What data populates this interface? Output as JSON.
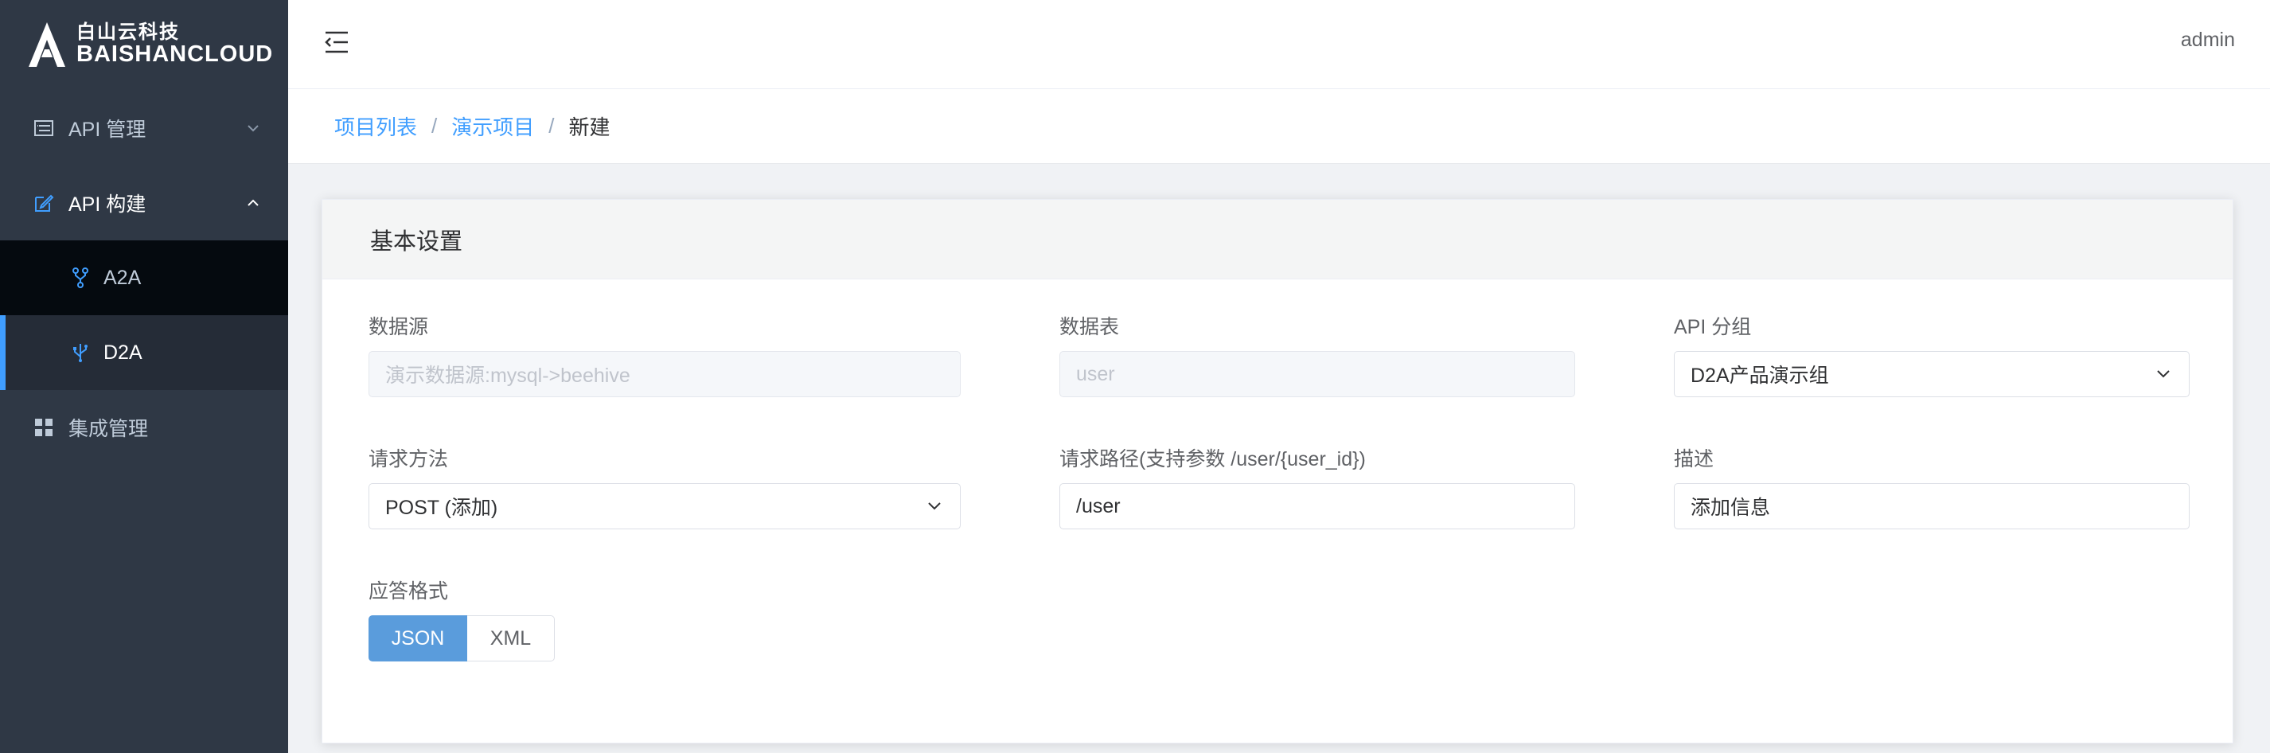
{
  "logo": {
    "cn": "白山云科技",
    "en": "BAISHANCLOUD"
  },
  "sidebar": {
    "items": [
      {
        "label": "API 管理",
        "icon": "list-icon"
      },
      {
        "label": "API 构建",
        "icon": "edit-icon"
      },
      {
        "label": "集成管理",
        "icon": "grid-icon"
      }
    ],
    "submenu": [
      {
        "label": "A2A",
        "icon": "fork-icon"
      },
      {
        "label": "D2A",
        "icon": "usb-icon"
      }
    ]
  },
  "header": {
    "user": "admin"
  },
  "breadcrumb": {
    "item1": "项目列表",
    "item2": "演示项目",
    "current": "新建",
    "sep": "/"
  },
  "card": {
    "title": "基本设置",
    "datasource": {
      "label": "数据源",
      "placeholder": "演示数据源:mysql->beehive"
    },
    "datatable": {
      "label": "数据表",
      "placeholder": "user"
    },
    "api_group": {
      "label": "API 分组",
      "value": "D2A产品演示组"
    },
    "method": {
      "label": "请求方法",
      "value": "POST (添加)"
    },
    "path": {
      "label": "请求路径(支持参数 /user/{user_id})",
      "value": "/user"
    },
    "desc": {
      "label": "描述",
      "value": "添加信息"
    },
    "format": {
      "label": "应答格式",
      "options": [
        "JSON",
        "XML"
      ],
      "selected": "JSON"
    }
  },
  "colors": {
    "sidebar_bg": "#2f3845",
    "accent": "#409eff",
    "selected_btn": "#5a9cdc"
  }
}
